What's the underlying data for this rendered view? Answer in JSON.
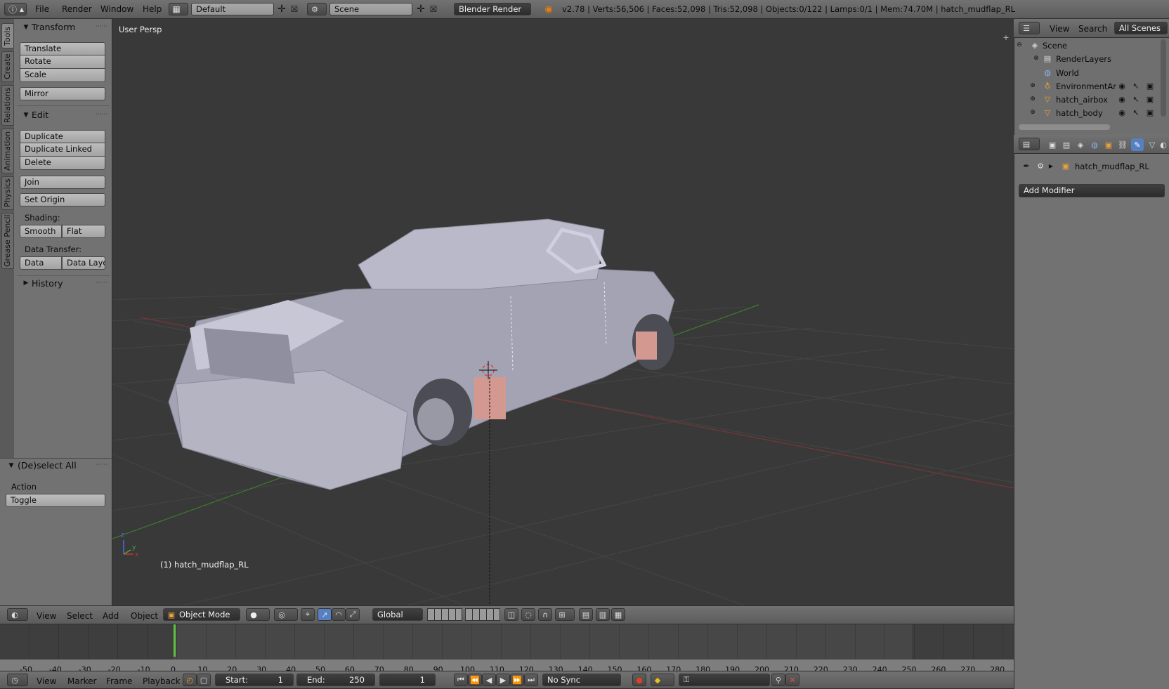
{
  "top_bar": {
    "menus": [
      "File",
      "Render",
      "Window",
      "Help"
    ],
    "screen_layout": "Default",
    "scene": "Scene",
    "render_engine": "Blender Render",
    "stats": "v2.78 | Verts:56,506 | Faces:52,098 | Tris:52,098 | Objects:0/122 | Lamps:0/1 | Mem:74.70M | hatch_mudflap_RL"
  },
  "tool_tabs": [
    "Tools",
    "Create",
    "Relations",
    "Animation",
    "Physics",
    "Grease Pencil"
  ],
  "tools_panel": {
    "transform": {
      "title": "Transform",
      "buttons": [
        "Translate",
        "Rotate",
        "Scale",
        "Mirror"
      ]
    },
    "edit": {
      "title": "Edit",
      "buttons": [
        "Duplicate",
        "Duplicate Linked",
        "Delete",
        "Join"
      ],
      "set_origin": "Set Origin",
      "shading_label": "Shading:",
      "shading_buttons": [
        "Smooth",
        "Flat"
      ],
      "data_transfer_label": "Data Transfer:",
      "data_buttons": [
        "Data",
        "Data Layo"
      ]
    },
    "history": {
      "title": "History"
    }
  },
  "operator_panel": {
    "title": "(De)select All",
    "action_label": "Action",
    "action_value": "Toggle"
  },
  "viewport": {
    "view_label": "User Persp",
    "object_label": "(1) hatch_mudflap_RL",
    "axis_labels": [
      "z",
      "x",
      "y"
    ]
  },
  "viewport_header": {
    "menus": [
      "View",
      "Select",
      "Add",
      "Object"
    ],
    "mode": "Object Mode",
    "orientation": "Global"
  },
  "timeline": {
    "ticks": [
      "-50",
      "-40",
      "-30",
      "-20",
      "-10",
      "0",
      "10",
      "20",
      "30",
      "40",
      "50",
      "60",
      "70",
      "80",
      "90",
      "100",
      "110",
      "120",
      "130",
      "140",
      "150",
      "160",
      "170",
      "180",
      "190",
      "200",
      "210",
      "220",
      "230",
      "240",
      "250",
      "260",
      "270",
      "280"
    ],
    "menus": [
      "View",
      "Marker",
      "Frame",
      "Playback"
    ],
    "start_label": "Start:",
    "start_value": "1",
    "end_label": "End:",
    "end_value": "250",
    "current_frame": "1",
    "sync": "No Sync"
  },
  "outliner": {
    "menus": [
      "View",
      "Search"
    ],
    "filter": "All Scenes",
    "rows": [
      "Scene",
      "RenderLayers",
      "World",
      "EnvironmentAml",
      "hatch_airbox",
      "hatch_body"
    ]
  },
  "properties": {
    "object_name": "hatch_mudflap_RL",
    "add_modifier": "Add Modifier"
  },
  "colors": {
    "accent_blue": "#5680c2",
    "bg": "#393939",
    "panel": "#727272"
  }
}
